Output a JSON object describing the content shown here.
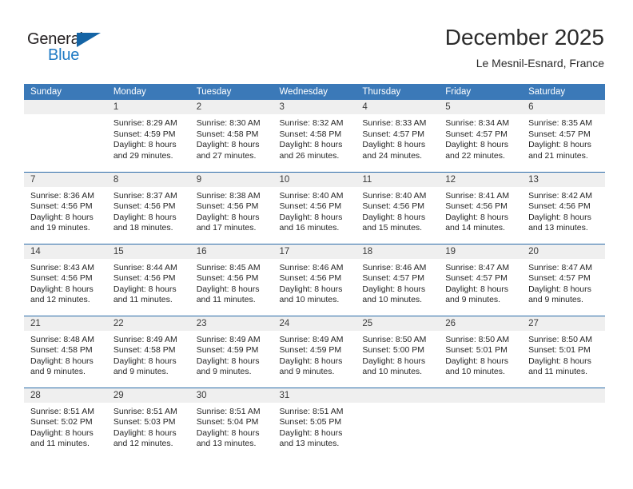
{
  "brand": {
    "name_part1": "General",
    "name_part2": "Blue",
    "triangle_icon": "triangle-icon"
  },
  "header": {
    "month_title": "December 2025",
    "location": "Le Mesnil-Esnard, France"
  },
  "calendar": {
    "weekday_headers": [
      "Sunday",
      "Monday",
      "Tuesday",
      "Wednesday",
      "Thursday",
      "Friday",
      "Saturday"
    ],
    "colors": {
      "header_blue": "#3b79b8",
      "row_divider_blue": "#2a6ba8",
      "daynum_strip_gray": "#efefef",
      "brand_blue": "#1f7ac4",
      "logo_triangle_blue": "#1464a5"
    },
    "weeks": [
      [
        {
          "day": "",
          "sunrise": "",
          "sunset": "",
          "daylight_line1": "",
          "daylight_line2": ""
        },
        {
          "day": "1",
          "sunrise": "Sunrise: 8:29 AM",
          "sunset": "Sunset: 4:59 PM",
          "daylight_line1": "Daylight: 8 hours",
          "daylight_line2": "and 29 minutes."
        },
        {
          "day": "2",
          "sunrise": "Sunrise: 8:30 AM",
          "sunset": "Sunset: 4:58 PM",
          "daylight_line1": "Daylight: 8 hours",
          "daylight_line2": "and 27 minutes."
        },
        {
          "day": "3",
          "sunrise": "Sunrise: 8:32 AM",
          "sunset": "Sunset: 4:58 PM",
          "daylight_line1": "Daylight: 8 hours",
          "daylight_line2": "and 26 minutes."
        },
        {
          "day": "4",
          "sunrise": "Sunrise: 8:33 AM",
          "sunset": "Sunset: 4:57 PM",
          "daylight_line1": "Daylight: 8 hours",
          "daylight_line2": "and 24 minutes."
        },
        {
          "day": "5",
          "sunrise": "Sunrise: 8:34 AM",
          "sunset": "Sunset: 4:57 PM",
          "daylight_line1": "Daylight: 8 hours",
          "daylight_line2": "and 22 minutes."
        },
        {
          "day": "6",
          "sunrise": "Sunrise: 8:35 AM",
          "sunset": "Sunset: 4:57 PM",
          "daylight_line1": "Daylight: 8 hours",
          "daylight_line2": "and 21 minutes."
        }
      ],
      [
        {
          "day": "7",
          "sunrise": "Sunrise: 8:36 AM",
          "sunset": "Sunset: 4:56 PM",
          "daylight_line1": "Daylight: 8 hours",
          "daylight_line2": "and 19 minutes."
        },
        {
          "day": "8",
          "sunrise": "Sunrise: 8:37 AM",
          "sunset": "Sunset: 4:56 PM",
          "daylight_line1": "Daylight: 8 hours",
          "daylight_line2": "and 18 minutes."
        },
        {
          "day": "9",
          "sunrise": "Sunrise: 8:38 AM",
          "sunset": "Sunset: 4:56 PM",
          "daylight_line1": "Daylight: 8 hours",
          "daylight_line2": "and 17 minutes."
        },
        {
          "day": "10",
          "sunrise": "Sunrise: 8:40 AM",
          "sunset": "Sunset: 4:56 PM",
          "daylight_line1": "Daylight: 8 hours",
          "daylight_line2": "and 16 minutes."
        },
        {
          "day": "11",
          "sunrise": "Sunrise: 8:40 AM",
          "sunset": "Sunset: 4:56 PM",
          "daylight_line1": "Daylight: 8 hours",
          "daylight_line2": "and 15 minutes."
        },
        {
          "day": "12",
          "sunrise": "Sunrise: 8:41 AM",
          "sunset": "Sunset: 4:56 PM",
          "daylight_line1": "Daylight: 8 hours",
          "daylight_line2": "and 14 minutes."
        },
        {
          "day": "13",
          "sunrise": "Sunrise: 8:42 AM",
          "sunset": "Sunset: 4:56 PM",
          "daylight_line1": "Daylight: 8 hours",
          "daylight_line2": "and 13 minutes."
        }
      ],
      [
        {
          "day": "14",
          "sunrise": "Sunrise: 8:43 AM",
          "sunset": "Sunset: 4:56 PM",
          "daylight_line1": "Daylight: 8 hours",
          "daylight_line2": "and 12 minutes."
        },
        {
          "day": "15",
          "sunrise": "Sunrise: 8:44 AM",
          "sunset": "Sunset: 4:56 PM",
          "daylight_line1": "Daylight: 8 hours",
          "daylight_line2": "and 11 minutes."
        },
        {
          "day": "16",
          "sunrise": "Sunrise: 8:45 AM",
          "sunset": "Sunset: 4:56 PM",
          "daylight_line1": "Daylight: 8 hours",
          "daylight_line2": "and 11 minutes."
        },
        {
          "day": "17",
          "sunrise": "Sunrise: 8:46 AM",
          "sunset": "Sunset: 4:56 PM",
          "daylight_line1": "Daylight: 8 hours",
          "daylight_line2": "and 10 minutes."
        },
        {
          "day": "18",
          "sunrise": "Sunrise: 8:46 AM",
          "sunset": "Sunset: 4:57 PM",
          "daylight_line1": "Daylight: 8 hours",
          "daylight_line2": "and 10 minutes."
        },
        {
          "day": "19",
          "sunrise": "Sunrise: 8:47 AM",
          "sunset": "Sunset: 4:57 PM",
          "daylight_line1": "Daylight: 8 hours",
          "daylight_line2": "and 9 minutes."
        },
        {
          "day": "20",
          "sunrise": "Sunrise: 8:47 AM",
          "sunset": "Sunset: 4:57 PM",
          "daylight_line1": "Daylight: 8 hours",
          "daylight_line2": "and 9 minutes."
        }
      ],
      [
        {
          "day": "21",
          "sunrise": "Sunrise: 8:48 AM",
          "sunset": "Sunset: 4:58 PM",
          "daylight_line1": "Daylight: 8 hours",
          "daylight_line2": "and 9 minutes."
        },
        {
          "day": "22",
          "sunrise": "Sunrise: 8:49 AM",
          "sunset": "Sunset: 4:58 PM",
          "daylight_line1": "Daylight: 8 hours",
          "daylight_line2": "and 9 minutes."
        },
        {
          "day": "23",
          "sunrise": "Sunrise: 8:49 AM",
          "sunset": "Sunset: 4:59 PM",
          "daylight_line1": "Daylight: 8 hours",
          "daylight_line2": "and 9 minutes."
        },
        {
          "day": "24",
          "sunrise": "Sunrise: 8:49 AM",
          "sunset": "Sunset: 4:59 PM",
          "daylight_line1": "Daylight: 8 hours",
          "daylight_line2": "and 9 minutes."
        },
        {
          "day": "25",
          "sunrise": "Sunrise: 8:50 AM",
          "sunset": "Sunset: 5:00 PM",
          "daylight_line1": "Daylight: 8 hours",
          "daylight_line2": "and 10 minutes."
        },
        {
          "day": "26",
          "sunrise": "Sunrise: 8:50 AM",
          "sunset": "Sunset: 5:01 PM",
          "daylight_line1": "Daylight: 8 hours",
          "daylight_line2": "and 10 minutes."
        },
        {
          "day": "27",
          "sunrise": "Sunrise: 8:50 AM",
          "sunset": "Sunset: 5:01 PM",
          "daylight_line1": "Daylight: 8 hours",
          "daylight_line2": "and 11 minutes."
        }
      ],
      [
        {
          "day": "28",
          "sunrise": "Sunrise: 8:51 AM",
          "sunset": "Sunset: 5:02 PM",
          "daylight_line1": "Daylight: 8 hours",
          "daylight_line2": "and 11 minutes."
        },
        {
          "day": "29",
          "sunrise": "Sunrise: 8:51 AM",
          "sunset": "Sunset: 5:03 PM",
          "daylight_line1": "Daylight: 8 hours",
          "daylight_line2": "and 12 minutes."
        },
        {
          "day": "30",
          "sunrise": "Sunrise: 8:51 AM",
          "sunset": "Sunset: 5:04 PM",
          "daylight_line1": "Daylight: 8 hours",
          "daylight_line2": "and 13 minutes."
        },
        {
          "day": "31",
          "sunrise": "Sunrise: 8:51 AM",
          "sunset": "Sunset: 5:05 PM",
          "daylight_line1": "Daylight: 8 hours",
          "daylight_line2": "and 13 minutes."
        },
        {
          "day": "",
          "sunrise": "",
          "sunset": "",
          "daylight_line1": "",
          "daylight_line2": ""
        },
        {
          "day": "",
          "sunrise": "",
          "sunset": "",
          "daylight_line1": "",
          "daylight_line2": ""
        },
        {
          "day": "",
          "sunrise": "",
          "sunset": "",
          "daylight_line1": "",
          "daylight_line2": ""
        }
      ]
    ]
  }
}
